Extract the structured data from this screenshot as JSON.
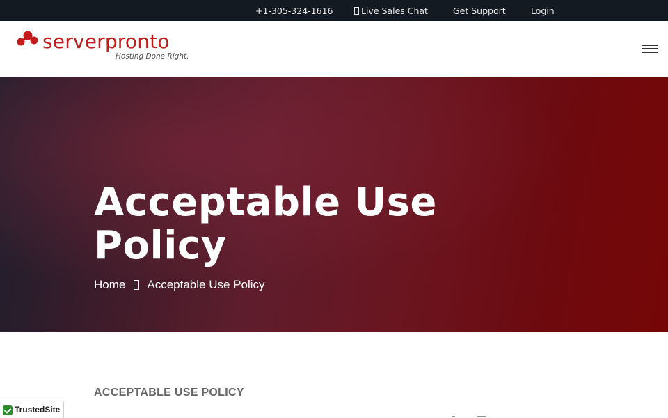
{
  "topbar": {
    "phone": "+1-305-324-1616",
    "chat": "Live Sales Chat",
    "chat_icon": "chat-icon",
    "support": "Get Support",
    "login": "Login"
  },
  "header": {
    "logo_text": "serverpronto",
    "tagline": "Hosting Done Right.",
    "menu_icon": "hamburger-menu-icon"
  },
  "hero": {
    "title": "Acceptable Use Policy",
    "breadcrumb": {
      "home": "Home",
      "separator_icon": "chevron-right-icon",
      "current": "Acceptable Use Policy"
    }
  },
  "content": {
    "section_heading": "ACCEPTABLE USE POLICY"
  },
  "badge": {
    "label": "TrustedSite",
    "icon": "checkmark-icon"
  },
  "colors": {
    "topbar_bg": "#141a22",
    "brand_red": "#c21c1c",
    "hero_dark": "#1b1f2e",
    "hero_red": "#760606",
    "badge_green": "#2c8a2c"
  }
}
